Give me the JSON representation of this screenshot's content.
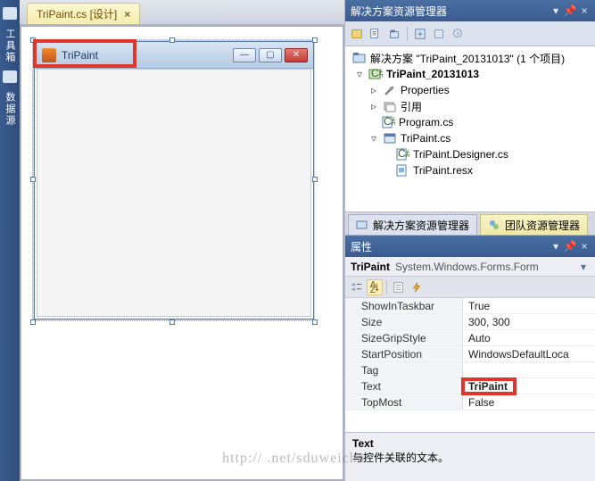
{
  "leftRail": {
    "items": [
      "工具箱",
      "数据源"
    ]
  },
  "tab": {
    "label": "TriPaint.cs [设计]"
  },
  "form": {
    "title": "TriPaint"
  },
  "solutionExplorer": {
    "title": "解决方案资源管理器",
    "solutionLine": "解决方案 \"TriPaint_20131013\" (1 个项目)",
    "project": "TriPaint_20131013",
    "nodes": {
      "properties": "Properties",
      "references": "引用",
      "program": "Program.cs",
      "tripaint": "TriPaint.cs",
      "designer": "TriPaint.Designer.cs",
      "resx": "TriPaint.resx"
    }
  },
  "rightTabs": {
    "sln": "解决方案资源管理器",
    "team": "团队资源管理器"
  },
  "propsPanel": {
    "title": "属性",
    "objName": "TriPaint",
    "objType": "System.Windows.Forms.Form",
    "rows": [
      {
        "name": "ShowInTaskbar",
        "value": "True"
      },
      {
        "name": "Size",
        "value": "300, 300"
      },
      {
        "name": "SizeGripStyle",
        "value": "Auto"
      },
      {
        "name": "StartPosition",
        "value": "WindowsDefaultLoca"
      },
      {
        "name": "Tag",
        "value": ""
      },
      {
        "name": "Text",
        "value": "TriPaint"
      },
      {
        "name": "TopMost",
        "value": "False"
      }
    ],
    "desc": {
      "title": "Text",
      "body": "与控件关联的文本。"
    }
  },
  "watermark": "http://                 .net/sduweichao"
}
